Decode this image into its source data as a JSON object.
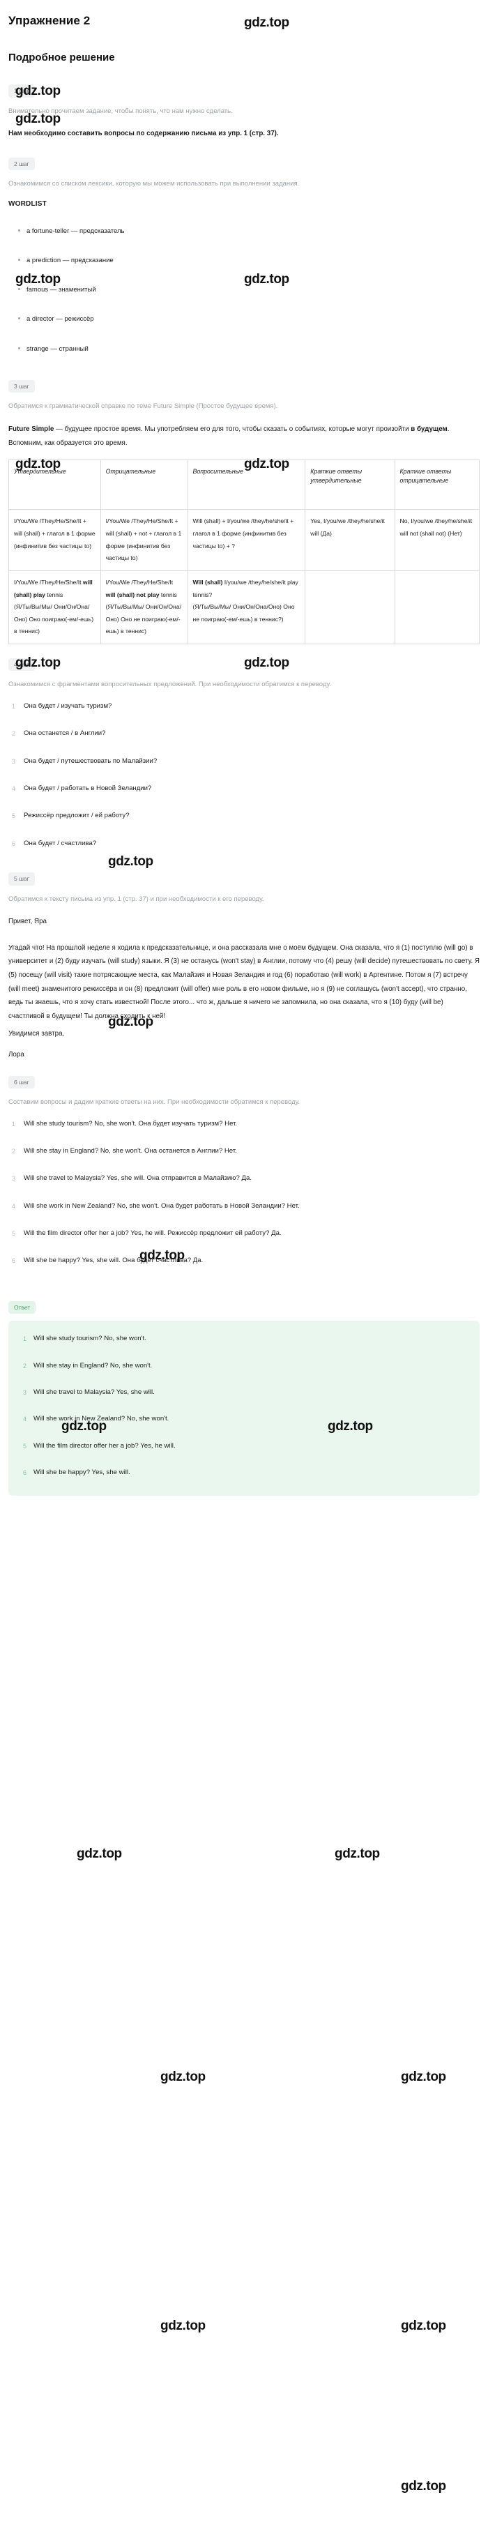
{
  "exercise": {
    "title": "Упражнение 2",
    "solution_title": "Подробное решение"
  },
  "watermark": {
    "text": "gdz.top"
  },
  "steps": {
    "s1": {
      "badge": "1 шаг",
      "muted": "Внимательно прочитаем задание, чтобы понять, что нам нужно сделать.",
      "bold": "Нам необходимо составить вопросы по содержанию письма из упр. 1 (стр. 37)."
    },
    "s2": {
      "badge": "2 шаг",
      "muted": "Ознакомимся со списком лексики, которую мы можем использовать при выполнении задания.",
      "wordlist_title": "WORDLIST",
      "words": [
        "a fortune-teller — предсказатель",
        "a prediction — предсказание",
        "famous — знаменитый",
        "a director — режиссёр",
        "strange — странный"
      ]
    },
    "s3": {
      "badge": "3 шаг",
      "muted": "Обратимся к грамматической справке по теме Future Simple (Простое будущее время).",
      "intro_bold": "Future Simple",
      "intro_rest": " — будущее простое время. Мы употребляем его для того, чтобы сказать о событиях, которые могут произойти ",
      "intro_bold2": "в будущем",
      "intro_tail": ". Вспомним, как образуется это время."
    },
    "s4": {
      "badge": "4 шаг",
      "muted": "Ознакомимся с фрагментами вопросительных предложений. При необходимости обратимся к переводу.",
      "items": [
        "Она будет / изучать туризм?",
        "Она останется / в Англии?",
        "Она будет / путешествовать по Малайзии?",
        "Она будет / работать в Новой Зеландии?",
        "Режиссёр предложит / ей работу?",
        "Она будет / счастлива?"
      ]
    },
    "s5": {
      "badge": "5 шаг",
      "muted": "Обратимся к тексту письма из упр. 1 (стр. 37) и при необходимости к его переводу.",
      "greeting": "Привет, Яра",
      "letter": "Угадай что! На прошлой неделе я ходила к предсказательнице, и она рассказала мне о моём будущем. Она сказала, что я (1) поступлю (will go) в университет и (2) буду изучать (will study) языки. Я (3) не останусь (won't stay) в Англии, потому что (4) решу (will decide) путешествовать по свету. Я (5) посещу (will visit) такие потрясающие места, как Малайзия и Новая Зеландия и год (6) поработаю (will work) в Аргентине. Потом я (7) встречу (will meet) знаменитого режиссёра и он (8) предложит (will offer) мне роль в его новом фильме, но я (9) не соглашусь (won't accept), что странно, ведь ты знаешь, что я хочу стать известной! После этого... что ж, дальше я ничего не запомнила, но она сказала, что я (10) буду (will be) счастливой в будущем! Ты должна сходить к ней!",
      "bye": "Увидимся завтра,",
      "signature": "Лора"
    },
    "s6": {
      "badge": "6 шаг",
      "muted": "Составим вопросы и дадим краткие ответы на них. При необходимости обратимся к переводу.",
      "items": [
        "Will she study tourism? No, she won't. Она будет изучать туризм? Нет.",
        "Will she stay in England? No, she won't. Она останется в Англии? Нет.",
        "Will she travel to Malaysia? Yes, she will. Она отправится в Малайзию? Да.",
        "Will she work in New Zealand? No, she won't. Она будет работать в Новой Зеландии? Нет.",
        "Will the film director offer her a job? Yes, he will. Режиссёр предложит ей работу? Да.",
        "Will she be happy? Yes, she will. Она будет счастлива? Да."
      ]
    }
  },
  "answer": {
    "badge": "Ответ",
    "items": [
      "Will she study tourism? No, she won't.",
      "Will she stay in England? No, she won't.",
      "Will she travel to Malaysia? Yes, she will.",
      "Will she work in New Zealand? No, she won't.",
      "Will the film director offer her a job? Yes, he will.",
      "Will she be happy? Yes, she will."
    ]
  },
  "grammar_table": {
    "headers": [
      "Утвердительные",
      "Отрицательные",
      "Вопросительные",
      "Краткие ответы утвердительные",
      "Краткие ответы отрицательные"
    ],
    "row1": {
      "affirmative": "I/You/We /They/He/She/It + will (shall) + глагол в 1 форме (инфинитив без частицы to)",
      "negative": "I/You/We /They/He/She/It + will (shall) + not + глагол в 1 форме (инфинитив без частицы to)",
      "interrogative": "Will (shall) + I/you/we /they/he/she/it + глагол в 1 форме (инфинитив без частицы to) + ?",
      "short_yes": "Yes, I/you/we /they/he/she/it will (Да)",
      "short_no": "No, I/you/we /they/he/she/it will not (shall not) (Нет)"
    },
    "row2": {
      "affirmative_plain": "I/You/We /They/He/She/It ",
      "affirmative_bold": "will (shall) play",
      "affirmative_tail": " tennis",
      "affirmative_ru": "(Я/Ты/Вы/Мы/ Они/Он/Она/Оно) Оно поиграю(-ем/-ешь) в теннис)",
      "negative_plain": "I/You/We /They/He/She/It ",
      "negative_bold": "will (shall) not play",
      "negative_tail": " tennis",
      "negative_ru": "(Я/Ты/Вы/Мы/ Они/Он/Она/Оно) Оно не поиграю(-ем/-ешь) в теннис)",
      "interrogative_bold": "Will (shall)",
      "interrogative_plain": " I/you/we /they/he/she/it play tennis?",
      "interrogative_ru": "(Я/Ты/Вы/Мы/ Они/Он/Она/Оно) Оно не поиграю(-ем/-ешь) в теннис?)"
    }
  }
}
